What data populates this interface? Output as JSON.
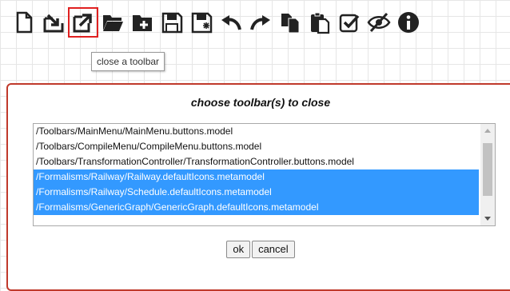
{
  "toolbar": {
    "icons": [
      "new-file-icon",
      "load-toolbar-icon",
      "close-toolbar-icon",
      "open-folder-icon",
      "add-folder-icon",
      "save-icon",
      "save-as-icon",
      "undo-icon",
      "redo-icon",
      "copy-icon",
      "paste-icon",
      "validate-icon",
      "hide-icon",
      "info-icon"
    ],
    "tooltip": "close a toolbar"
  },
  "dialog": {
    "title": "choose toolbar(s) to close",
    "items": [
      {
        "label": "/Toolbars/MainMenu/MainMenu.buttons.model",
        "selected": false
      },
      {
        "label": "/Toolbars/CompileMenu/CompileMenu.buttons.model",
        "selected": false
      },
      {
        "label": "/Toolbars/TransformationController/TransformationController.buttons.model",
        "selected": false
      },
      {
        "label": "/Formalisms/Railway/Railway.defaultIcons.metamodel",
        "selected": true
      },
      {
        "label": "/Formalisms/Railway/Schedule.defaultIcons.metamodel",
        "selected": true
      },
      {
        "label": "/Formalisms/GenericGraph/GenericGraph.defaultIcons.metamodel",
        "selected": true
      }
    ],
    "ok_label": "ok",
    "cancel_label": "cancel"
  },
  "colors": {
    "selection": "#3399ff",
    "dialog_border": "#c0392b",
    "active_outline": "#e02020"
  }
}
